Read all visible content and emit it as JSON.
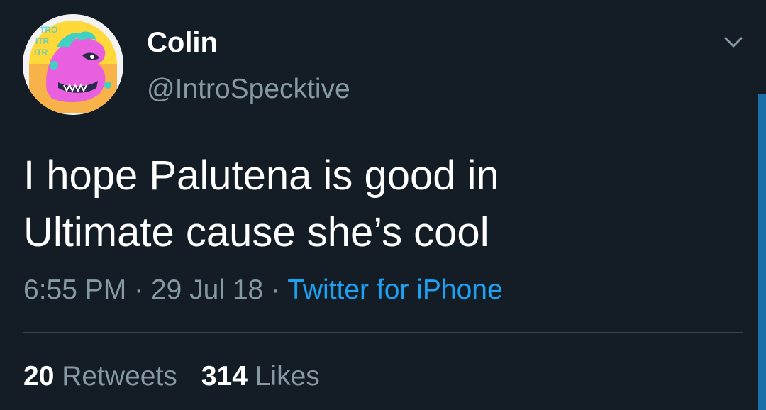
{
  "user": {
    "display_name": "Colin",
    "handle": "@IntroSpecktive",
    "avatar_icon": "avatar-image",
    "avatar_text": "TRO ITR ITR"
  },
  "menu": {
    "icon": "chevron-down-icon"
  },
  "tweet": {
    "text_line_1": "I hope Palutena is good in",
    "text_line_2": "Ultimate cause she’s cool",
    "time": "6:55 PM",
    "separator": " · ",
    "date": "29 Jul 18",
    "source": "Twitter for iPhone"
  },
  "stats": {
    "retweets_count": "20",
    "retweets_label": "Retweets",
    "likes_count": "314",
    "likes_label": "Likes"
  },
  "colors": {
    "background": "#141d26",
    "text": "#ffffff",
    "secondary_text": "#8899a6",
    "link": "#1da1f2",
    "divider": "#38444d",
    "scrollbar": "#1c6ea8"
  }
}
